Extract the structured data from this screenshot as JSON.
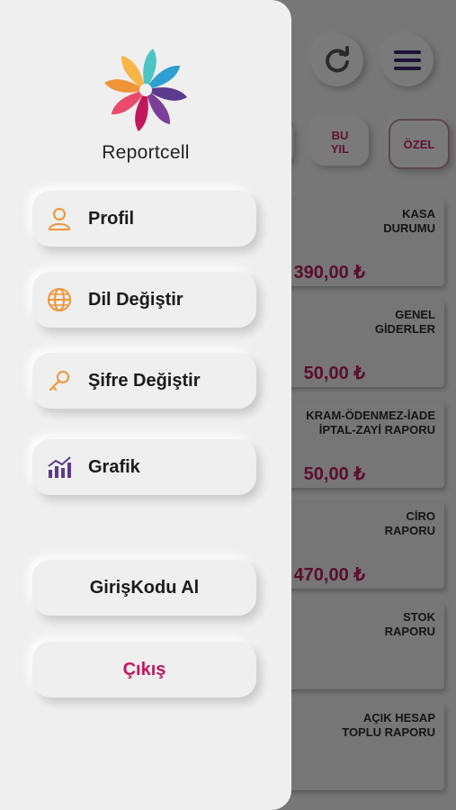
{
  "brand": {
    "name": "Reportcell"
  },
  "menu": {
    "profile": "Profil",
    "language": "Dil Değiştir",
    "password": "Şifre Değiştir",
    "chart": "Grafik",
    "code": "GirişKodu Al",
    "logout": "Çıkış"
  },
  "background": {
    "filters": {
      "this_year": "BU\nYIL",
      "custom": "ÖZEL"
    },
    "cards": [
      {
        "title": "KASA\nDURUMU",
        "amount": "390,00 ₺"
      },
      {
        "title": "GENEL\nGİDERLER",
        "amount": "50,00 ₺"
      },
      {
        "title": "KRAM-ÖDENMEZ-İADE\nİPTAL-ZAYİ RAPORU",
        "amount": "50,00 ₺"
      },
      {
        "title": "CİRO\nRAPORU",
        "amount": "470,00 ₺"
      },
      {
        "title": "STOK\nRAPORU",
        "amount": ""
      },
      {
        "title": "AÇIK HESAP\nTOPLU RAPORU",
        "amount": ""
      }
    ]
  },
  "icons": {
    "refresh": "refresh-icon",
    "hamburger": "hamburger-menu-icon",
    "user": "user-icon",
    "globe": "globe-icon",
    "key": "key-icon",
    "chart": "bar-chart-icon"
  },
  "colors": {
    "accent": "#c2185b",
    "icon_orange": "#f0943a",
    "icon_purple": "#5b3b8c"
  }
}
